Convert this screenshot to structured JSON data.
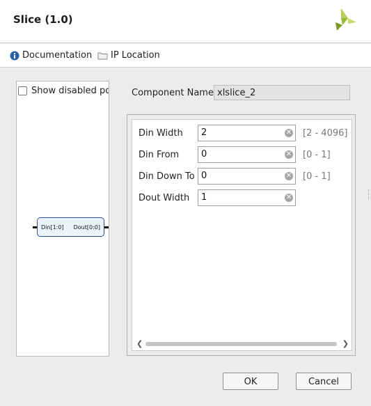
{
  "window": {
    "title": "Slice (1.0)"
  },
  "toolbar": {
    "documentation": {
      "label": "Documentation",
      "icon": "info-icon"
    },
    "ip_location": {
      "label": "IP Location",
      "icon": "folder-icon"
    }
  },
  "symbol_panel": {
    "show_disabled_label": "Show disabled po",
    "show_disabled_checked": false,
    "block": {
      "input_port": "Din[1:0]",
      "output_port": "Dout[0:0]"
    }
  },
  "component": {
    "label": "Component Name",
    "value": "xlslice_2"
  },
  "params": [
    {
      "label": "Din Width",
      "value": "2",
      "range": "[2 - 4096]"
    },
    {
      "label": "Din From",
      "value": "0",
      "range": "[0 - 1]"
    },
    {
      "label": "Din Down To",
      "value": "0",
      "range": "[0 - 1]"
    },
    {
      "label": "Dout Width",
      "value": "1",
      "range": ""
    }
  ],
  "buttons": {
    "ok": "OK",
    "cancel": "Cancel"
  },
  "colors": {
    "accent_green": "#9aba36",
    "info_blue": "#2a5fa8",
    "block_border": "#2f4f8f"
  }
}
